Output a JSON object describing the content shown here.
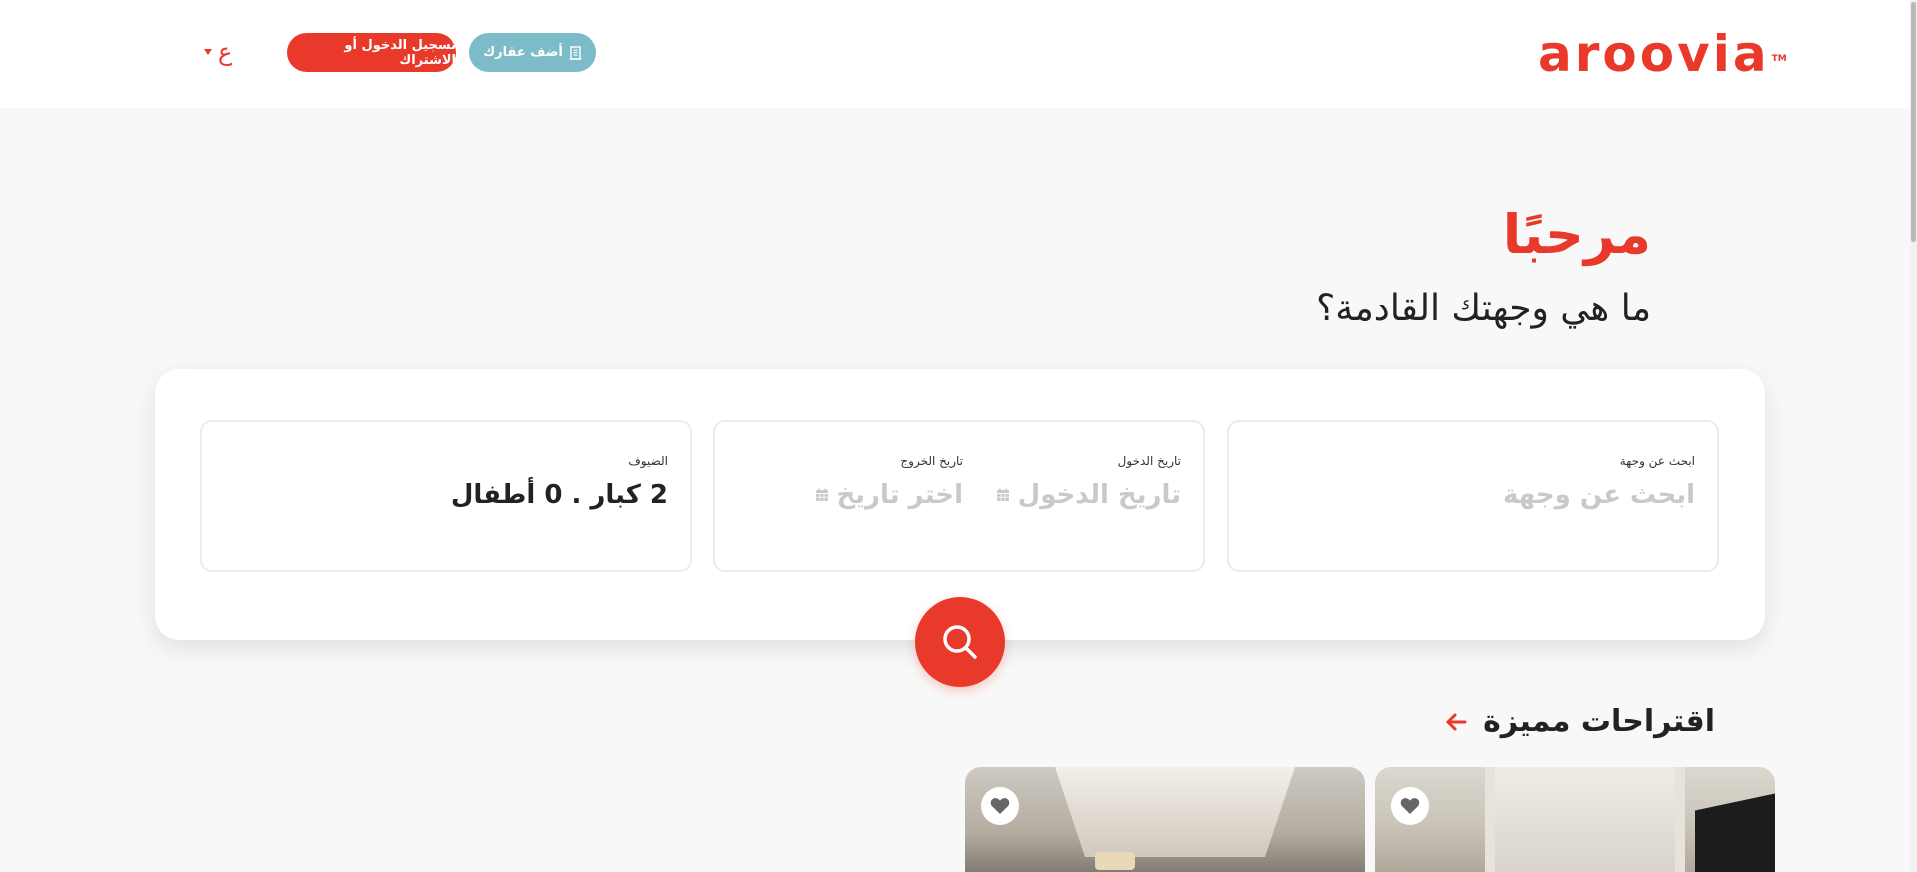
{
  "header": {
    "logo": "aroovia",
    "logo_tm": "TM",
    "add_property_label": "أضف عقارك",
    "login_label": "تسجيل الدخول أو الاشتراك",
    "language_label": "ع"
  },
  "hero": {
    "greeting": "مرحبًا",
    "subtitle": "ما هي وجهتك القادمة؟"
  },
  "search": {
    "destination_label": "ابحث عن وجهة",
    "destination_placeholder": "ابحث عن وجهة",
    "checkin_label": "تاريخ الدخول",
    "checkin_placeholder": "تاريخ الدخول",
    "checkout_label": "تاريخ الخروج",
    "checkout_placeholder": "اختر تاريخ",
    "guests_label": "الضيوف",
    "guests_value": "2 كبار . 0 أطفال"
  },
  "featured": {
    "title": "اقتراحات مميزة"
  },
  "colors": {
    "brand": "#e8392a",
    "secondary": "#7cbcc9"
  },
  "icons": [
    "building-icon",
    "caret-down-icon",
    "calendar-icon",
    "search-icon",
    "arrow-left-icon",
    "heart-icon"
  ]
}
